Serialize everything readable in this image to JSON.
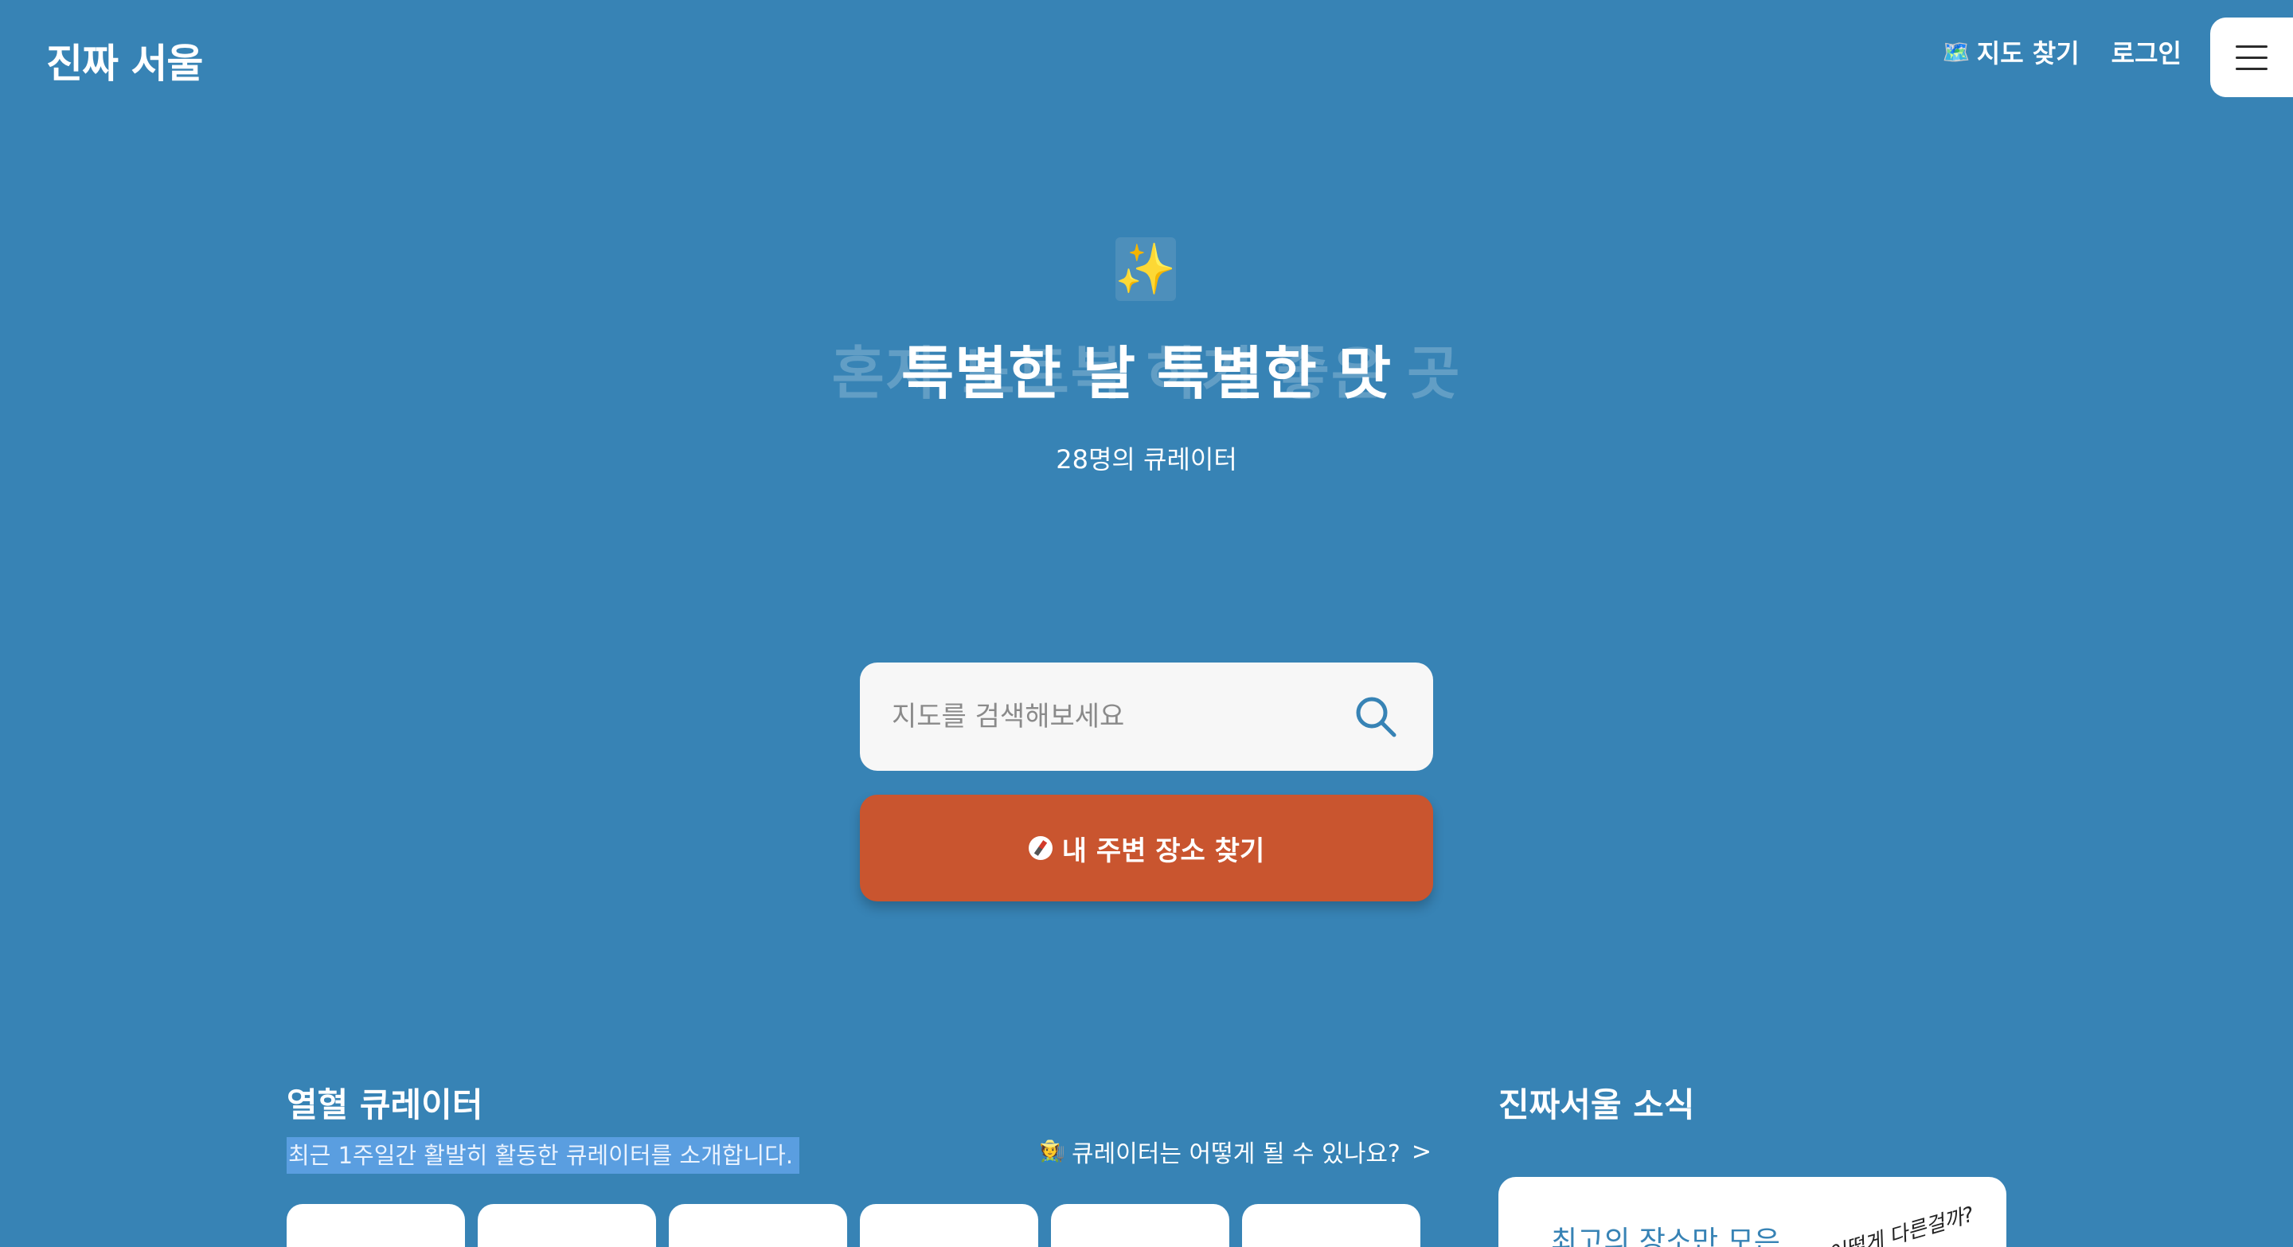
{
  "header": {
    "logo": "진짜 서울",
    "map_find_emoji": "🗺️",
    "map_find_label": "지도 찾기",
    "login_label": "로그인"
  },
  "hero": {
    "sparkle": "✨",
    "headline_ghost": "혼자 노트북 하기 좋은 곳",
    "headline": "특별한 날 특별한 맛",
    "curator_count": "28명의 큐레이터"
  },
  "search": {
    "placeholder": "지도를 검색해보세요"
  },
  "nearby": {
    "label": "내 주변 장소 찾기"
  },
  "curators": {
    "title": "열혈 큐레이터",
    "description": "최근 1주일간 활발히 활동한 큐레이터를 소개합니다.",
    "how_emoji": "🧑‍🌾",
    "how_link": "큐레이터는 어떻게 될 수 있나요?",
    "how_chevron": ">"
  },
  "news": {
    "title": "진짜서울 소식",
    "card_title": "최고의 장소만 모은",
    "card_tag": "어떻게 다른걸까?"
  },
  "colors": {
    "background": "#3783b5",
    "accent_button": "#c9552f",
    "surface": "#ffffff"
  }
}
